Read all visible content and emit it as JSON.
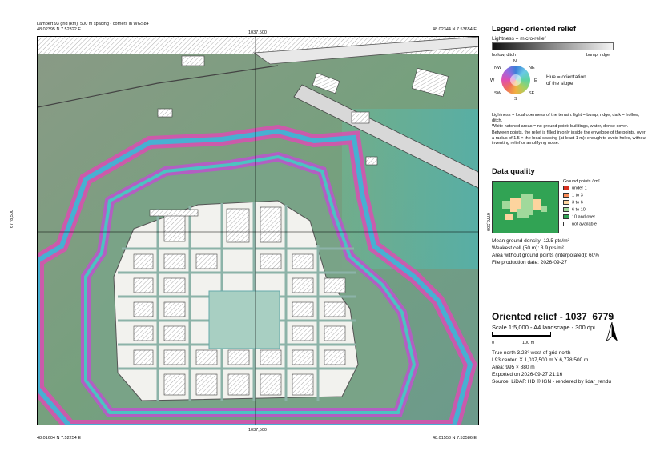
{
  "header": {
    "grid_line": "Lambert 93 grid (km), 500 m spacing - corners in WGS84",
    "tl_coord": "48.02395 N 7.52322 E",
    "tr_coord": "48.02344 N 7.53654 E",
    "bl_coord": "48.01604 N 7.52254 E",
    "br_coord": "48.01553 N 7.53586 E",
    "top_tick": "1037,500",
    "bottom_tick": "1037,500",
    "left_tick": "6778,500",
    "right_tick": "6778,500"
  },
  "legend": {
    "title": "Legend - oriented relief",
    "lightness_label": "Lightness = micro-relief",
    "hollow_label": "hollow, ditch",
    "bump_label": "bump, ridge",
    "compass": {
      "n": "N",
      "ne": "NE",
      "e": "E",
      "se": "SE",
      "s": "S",
      "sw": "SW",
      "w": "W",
      "nw": "NW"
    },
    "hue_line1": "Hue = orientation",
    "hue_line2": "of the slope",
    "note1": "Lightness = local openness of the terrain: light = bump, ridge; dark = hollow, ditch.",
    "note2": "White hatched areas = no ground point: buildings, water, dense cover.",
    "note3": "Between points, the relief is filled in only inside the envelope of the points, over a radius of 1.5 × the local spacing (at least 1 m): enough to avoid holes, without inventing relief or amplifying noise."
  },
  "quality": {
    "title": "Data quality",
    "ground_points_label": "Ground points / m²",
    "classes": [
      {
        "label": "under 1",
        "color": "#d7301f"
      },
      {
        "label": "1 to 3",
        "color": "#fc8d59"
      },
      {
        "label": "3 to 6",
        "color": "#fdd49e"
      },
      {
        "label": "6 to 10",
        "color": "#a1d99b"
      },
      {
        "label": "10 and over",
        "color": "#31a354"
      },
      {
        "label": "not available",
        "color": "#ffffff"
      }
    ],
    "mean_density": "Mean ground density: 12.5 pts/m²",
    "weakest_cell": "Weakest cell (50 m): 3.9 pts/m²",
    "area_without": "Area without ground points (interpolated): 60%",
    "production_date": "File production date: 2026-09-27"
  },
  "titleblock": {
    "title": "Oriented relief - 1037_6779",
    "scale": "Scale 1:5,000 - A4 landscape - 300 dpi",
    "scalebar_0": "0",
    "scalebar_100": "100 m",
    "north": "N",
    "true_north": "True north 3.28° west of grid north",
    "center": "L93 center: X 1,037,500 m  Y 6,778,500 m",
    "area": "Area: 995 × 880 m",
    "exported": "Exported on 2026-09-27 21:16",
    "source": "Source: LiDAR HD © IGN - rendered by lidar_rendu"
  },
  "colors": {
    "accent_magenta": "#d94fb2",
    "accent_cyan": "#38b9d6",
    "terrain_green": "#7fa07a",
    "quality_green": "#31a354"
  }
}
